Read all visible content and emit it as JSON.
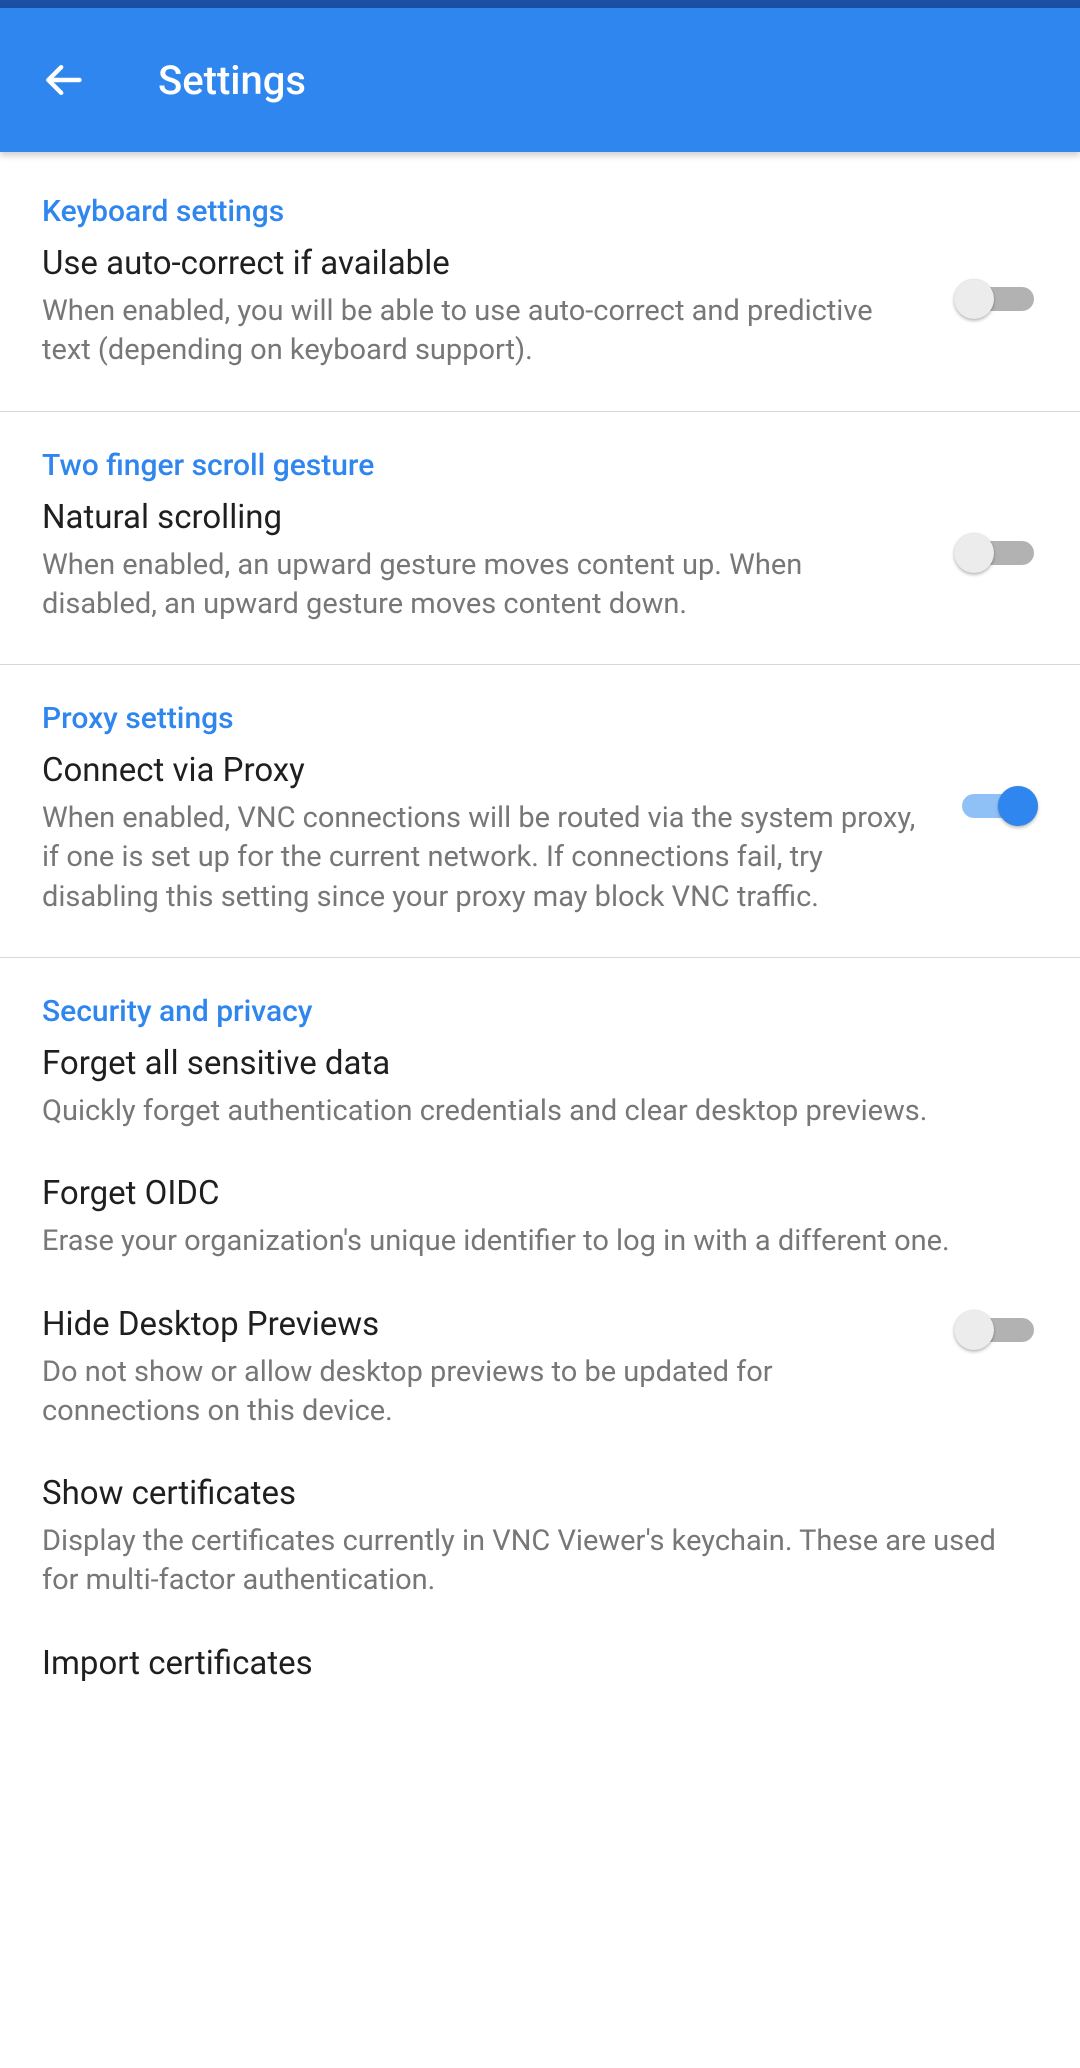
{
  "header": {
    "title": "Settings"
  },
  "sections": {
    "keyboard": {
      "header": "Keyboard settings",
      "item": {
        "title": "Use auto-correct if available",
        "desc": "When enabled, you will be able to use auto-correct and predictive text (depending on keyboard support).",
        "on": false
      }
    },
    "scroll": {
      "header": "Two finger scroll gesture",
      "item": {
        "title": "Natural scrolling",
        "desc": "When enabled, an upward gesture moves content up. When disabled, an upward gesture moves content down.",
        "on": false
      }
    },
    "proxy": {
      "header": "Proxy settings",
      "item": {
        "title": "Connect via Proxy",
        "desc": "When enabled, VNC connections will be routed via the system proxy, if one is set up for the current network. If connections fail, try disabling this setting since your proxy may block VNC traffic.",
        "on": true
      }
    },
    "security": {
      "header": "Security and privacy",
      "forget_sensitive": {
        "title": "Forget all sensitive data",
        "desc": "Quickly forget authentication credentials and clear desktop previews."
      },
      "forget_oidc": {
        "title": "Forget OIDC",
        "desc": "Erase your organization's unique identifier to log in with a different one."
      },
      "hide_previews": {
        "title": "Hide Desktop Previews",
        "desc": "Do not show or allow desktop previews to be updated for connections on this device.",
        "on": false
      },
      "show_certs": {
        "title": "Show certificates",
        "desc": "Display the certificates currently in VNC Viewer's keychain. These are used for multi-factor authentication."
      },
      "import_certs": {
        "title": "Import certificates"
      }
    }
  }
}
